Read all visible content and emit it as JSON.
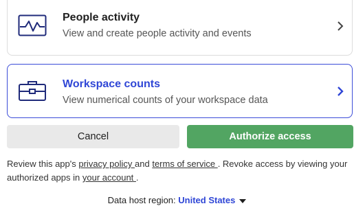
{
  "scopes": [
    {
      "title": "People activity",
      "description": "View and create people activity and events",
      "icon": "activity-chart-icon",
      "selected": false
    },
    {
      "title": "Workspace counts",
      "description": "View numerical counts of your workspace data",
      "icon": "briefcase-icon",
      "selected": true
    }
  ],
  "actions": {
    "cancel_label": "Cancel",
    "authorize_label": "Authorize access"
  },
  "review": {
    "prefix": "Review this app's ",
    "privacy_link": "privacy policy ",
    "and": "and ",
    "terms_link": "terms of service ",
    "middle": ". Revoke access by viewing your authorized apps in ",
    "account_link": "your account ",
    "suffix": "."
  },
  "region": {
    "label": "Data host region: ",
    "value": "United States"
  },
  "colors": {
    "accent": "#2f46d6",
    "authorize": "#52a562"
  }
}
